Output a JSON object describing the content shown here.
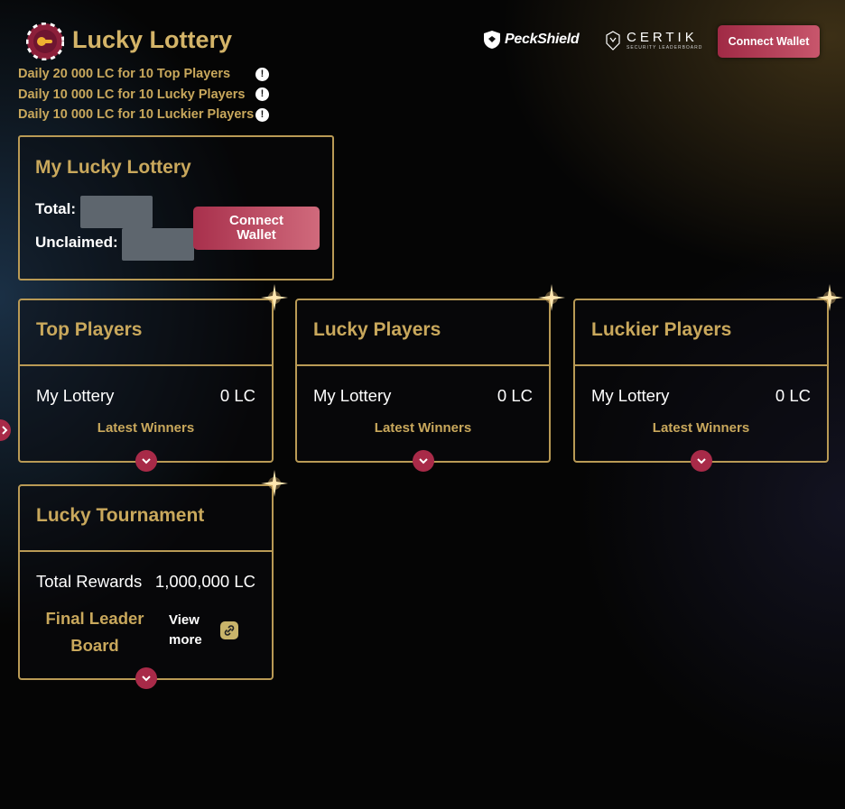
{
  "header": {
    "title": "Lucky Lottery",
    "info_lines": [
      "Daily 20 000 LC for 10 Top Players",
      "Daily 10 000 LC for 10 Lucky Players",
      "Daily 10 000 LC for 10 Luckier Players"
    ],
    "partners": {
      "peckshield": "PeckShield",
      "certik": "CERTIK",
      "certik_sub": "SECURITY LEADERBOARD"
    },
    "connect_wallet": "Connect Wallet"
  },
  "my_lottery": {
    "title": "My Lucky Lottery",
    "total_label": "Total:",
    "unclaimed_label": "Unclaimed:",
    "connect_line1": "Connect",
    "connect_line2": "Wallet"
  },
  "cards": [
    {
      "title": "Top Players",
      "row_label": "My Lottery",
      "row_value": "0 LC",
      "link": "Latest Winners"
    },
    {
      "title": "Lucky Players",
      "row_label": "My Lottery",
      "row_value": "0 LC",
      "link": "Latest Winners"
    },
    {
      "title": "Luckier Players",
      "row_label": "My Lottery",
      "row_value": "0 LC",
      "link": "Latest Winners"
    }
  ],
  "tournament": {
    "title": "Lucky Tournament",
    "rewards_label": "Total Rewards",
    "rewards_value": "1,000,000 LC",
    "board_label": "Final Leader Board",
    "view_more": "View more"
  },
  "colors": {
    "gold": "#c9a85c",
    "accent": "#a82a48"
  }
}
